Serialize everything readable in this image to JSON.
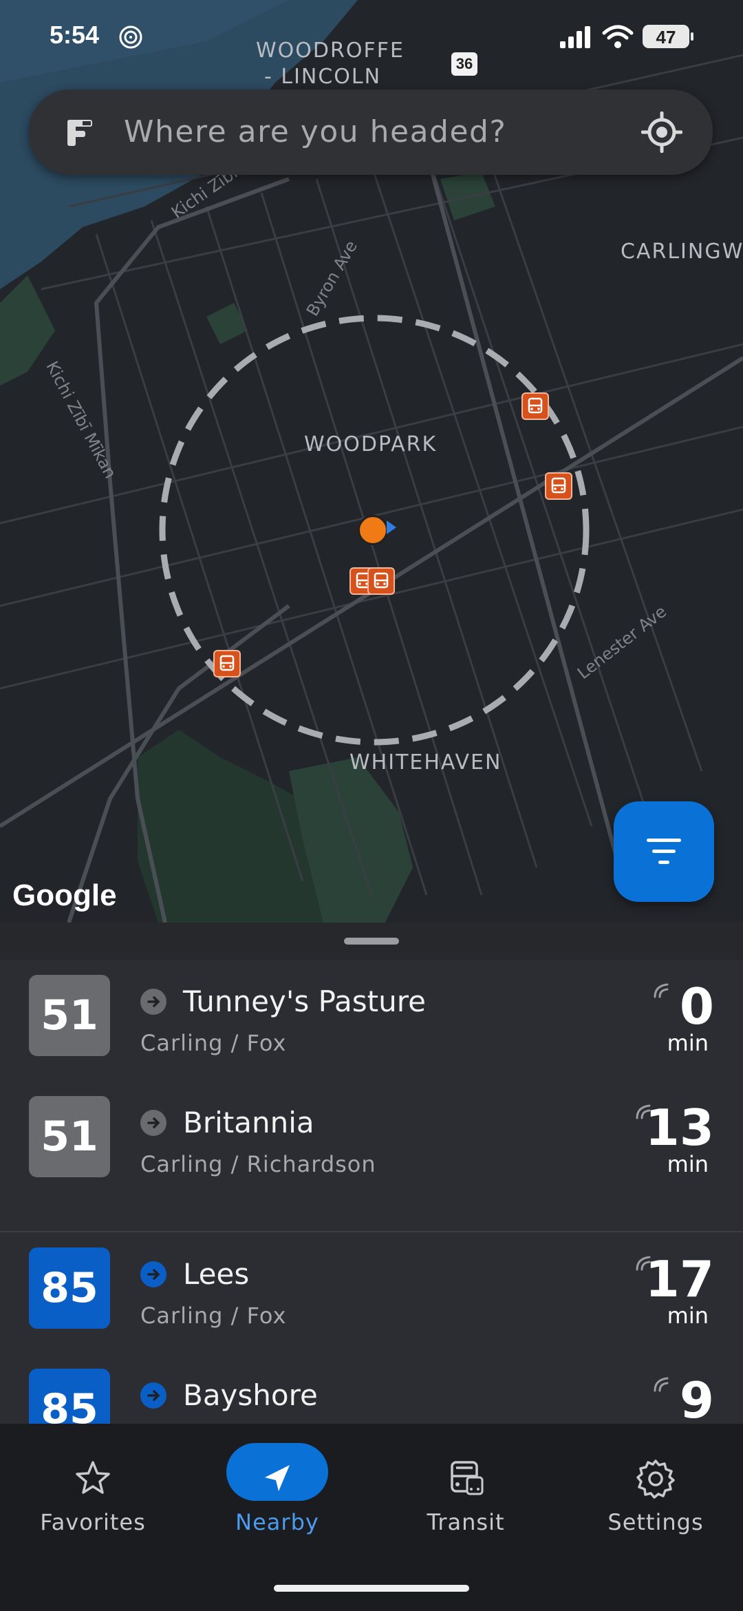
{
  "status_bar": {
    "time": "5:54",
    "battery": "47"
  },
  "search": {
    "placeholder": "Where are you headed?"
  },
  "map": {
    "neighborhoods": [
      "WOODROFFE",
      "- LINCOLN",
      "WOODPARK",
      "WHITEHAVEN",
      "CARLINGW"
    ],
    "streets": [
      "Kichi Zībī Mīkan",
      "Kichi Zībī Mīkan",
      "Byron Ave",
      "Lenester Ave"
    ],
    "route_shield": "36",
    "attribution": "Google"
  },
  "departures": [
    {
      "route": "51",
      "badge_color": "#6a6b6f",
      "direction_color": "#6a6b6f",
      "destination": "Tunney's Pasture",
      "stop": "Carling / Fox",
      "eta": "0",
      "unit": "min"
    },
    {
      "route": "51",
      "badge_color": "#6a6b6f",
      "direction_color": "#6a6b6f",
      "destination": "Britannia",
      "stop": "Carling / Richardson",
      "eta": "13",
      "unit": "min"
    },
    {
      "route": "85",
      "badge_color": "#0a5fc7",
      "direction_color": "#0a5fc7",
      "destination": "Lees",
      "stop": "Carling / Fox",
      "eta": "17",
      "unit": "min"
    },
    {
      "route": "85",
      "badge_color": "#0a5fc7",
      "direction_color": "#0a5fc7",
      "destination": "Bayshore",
      "stop": "",
      "eta": "9",
      "unit": ""
    }
  ],
  "tabs": [
    {
      "label": "Favorites",
      "icon": "star-icon",
      "active": false
    },
    {
      "label": "Nearby",
      "icon": "navigation-arrow-icon",
      "active": true
    },
    {
      "label": "Transit",
      "icon": "bus-icon",
      "active": false
    },
    {
      "label": "Settings",
      "icon": "gear-icon",
      "active": false
    }
  ],
  "colors": {
    "accent": "#0a72d6",
    "stop_marker": "#d6521c",
    "user_location": "#f07a14"
  }
}
